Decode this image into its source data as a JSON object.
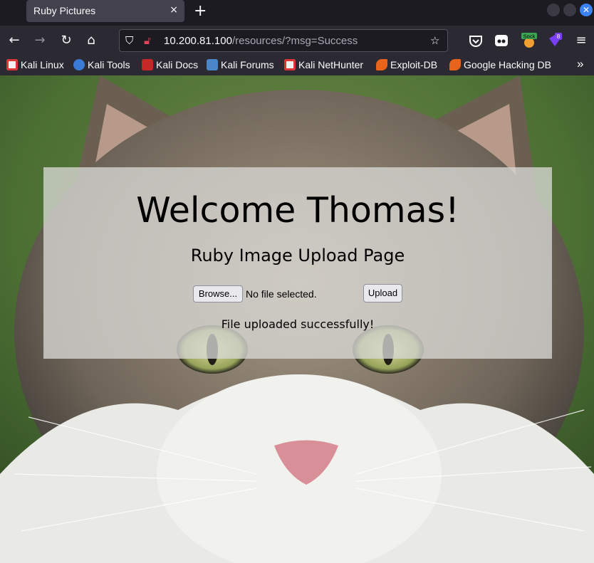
{
  "browser": {
    "tab_title": "Ruby Pictures",
    "tab_close": "×",
    "new_tab": "+",
    "url_host": "10.200.81.100",
    "url_path": "/resources/?msg=Success",
    "ext_sock_label": "Sock",
    "ext_badge_count": "8",
    "bookmarks": [
      "Kali Linux",
      "Kali Tools",
      "Kali Docs",
      "Kali Forums",
      "Kali NetHunter",
      "Exploit-DB",
      "Google Hacking DB"
    ],
    "overflow": "»"
  },
  "page": {
    "heading": "Welcome Thomas!",
    "subtitle": "Ruby Image Upload Page",
    "browse_label": "Browse...",
    "no_file_text": "No file selected.",
    "upload_label": "Upload",
    "status_message": "File uploaded successfully!"
  },
  "colors": {
    "accent": "#3b82f6",
    "toolbar": "#2b2a33",
    "tabstrip": "#1c1b22",
    "panel_overlay": "#d7d7d4"
  }
}
